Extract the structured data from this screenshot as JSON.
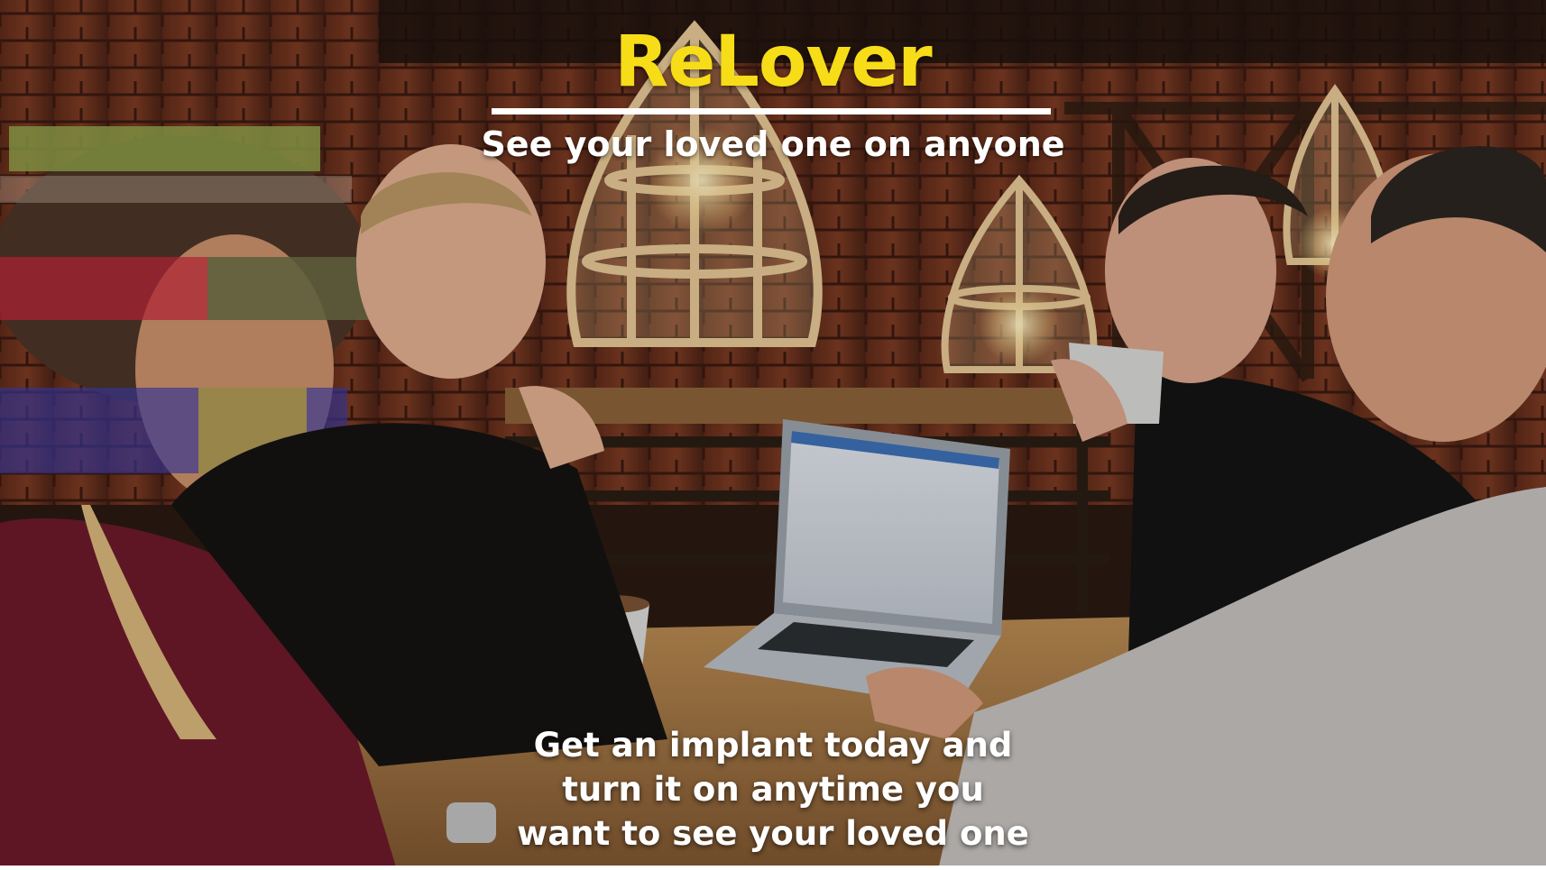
{
  "overlay": {
    "brand": "ReLover",
    "tagline": "See your loved one on anyone",
    "caption_lines": [
      "Get an implant today and",
      "turn it on anytime you",
      "want to see your loved one"
    ]
  },
  "colors": {
    "brand": "#f7dc18",
    "text": "#ffffff",
    "brick": "#6e3420",
    "table": "#a2743f"
  }
}
